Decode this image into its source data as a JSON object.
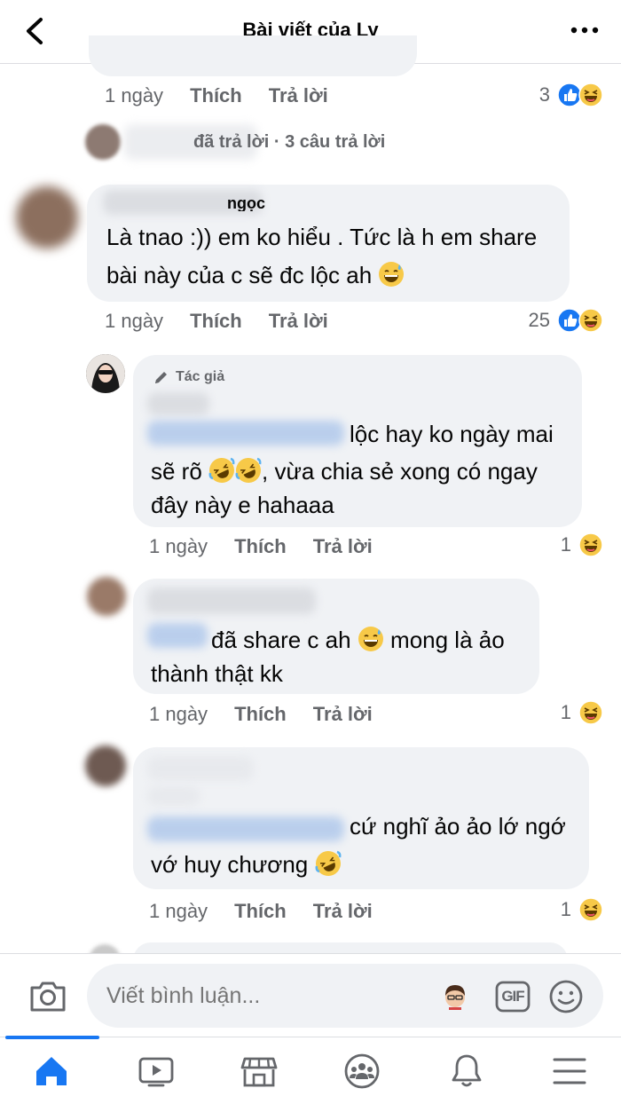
{
  "header": {
    "title": "Bài viết của Ly"
  },
  "top_comment": {
    "time": "1 ngày",
    "like": "Thích",
    "reply": "Trả lời",
    "reactions": "3",
    "replies_summary": "đã trả lời · 3 câu trả lời"
  },
  "comments": [
    {
      "name_partial": "ngọc",
      "text": "Là tnao :)) em ko hiểu . Tức là h em share",
      "text2": "bài này của c sẽ đc lộc ah",
      "time": "1 ngày",
      "like": "Thích",
      "reply": "Trả lời",
      "reactions": "25"
    },
    {
      "author_tag": "Tác giả",
      "text": "lộc hay ko ngày mai",
      "text2": "sẽ rõ",
      "text2b": ", vừa chia sẻ xong có ngay",
      "text3": "đây này e hahaaa",
      "time": "1 ngày",
      "like": "Thích",
      "reply": "Trả lời",
      "reactions": "1"
    },
    {
      "text": "đã share c ah",
      "text_b": "mong là ảo",
      "text2": "thành thật kk",
      "time": "1 ngày",
      "like": "Thích",
      "reply": "Trả lời",
      "reactions": "1"
    },
    {
      "text": "cứ nghĩ ảo ảo lớ ngớ",
      "text2": "vớ huy chương",
      "time": "1 ngày",
      "like": "Thích",
      "reply": "Trả lời",
      "reactions": "1"
    }
  ],
  "composer": {
    "placeholder": "Viết bình luận...",
    "gif_label": "GIF"
  },
  "tabs": [
    {
      "icon": "home-icon",
      "active": true
    },
    {
      "icon": "video-icon"
    },
    {
      "icon": "marketplace-icon"
    },
    {
      "icon": "groups-icon"
    },
    {
      "icon": "notifications-icon"
    },
    {
      "icon": "menu-icon"
    }
  ],
  "colors": {
    "accent": "#1877f2",
    "bubble": "#f0f2f5",
    "meta": "#65676b"
  }
}
